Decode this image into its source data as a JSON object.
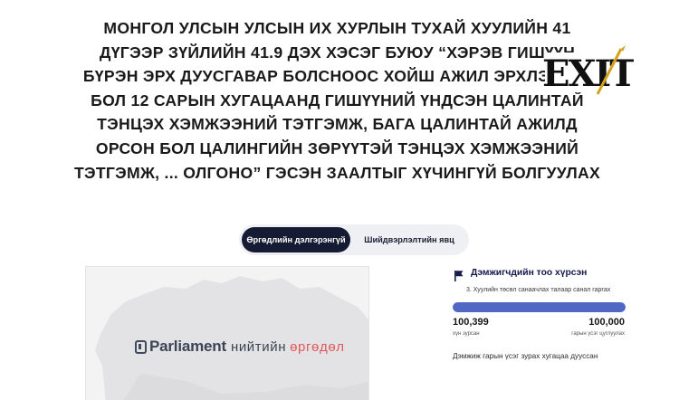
{
  "petition": {
    "title_lines": [
      "МОНГОЛ УЛСЫН УЛСЫН ИХ ХУРЛЫН ТУХАЙ ХУУЛИЙН 41",
      "ДҮГЭЭР ЗҮЙЛИЙН 41.9 ДЭХ ХЭСЭГ БУЮУ “ХЭРЭВ ГИШҮҮН",
      "БҮРЭН ЭРХ ДУУСГАВАР БОЛСНООС ХОЙШ АЖИЛ ЭРХЛЭЭГҮЙ",
      "БОЛ 12 САРЫН ХУГАЦААНД ГИШҮҮНИЙ ҮНДСЭН ЦАЛИНТАЙ",
      "ТЭНЦЭХ ХЭМЖЭЭНИЙ ТЭТГЭМЖ, БАГА ЦАЛИНТАЙ АЖИЛД",
      "ОРСОН БОЛ ЦАЛИНГИЙН ЗӨРҮҮТЭЙ ТЭНЦЭХ ХЭМЖЭЭНИЙ",
      "ТЭТГЭМЖ, ... ОЛГОНО” ГЭСЭН ЗААЛТЫГ ХҮЧИНГҮЙ БОЛГУУЛАХ"
    ]
  },
  "watermark": {
    "text": "EXIT"
  },
  "tabs": {
    "details": "Өргөдлийн дэлгэрэнгүй",
    "decision": "Шийдвэрлэлтийн явц"
  },
  "banner": {
    "brand": "Parliament",
    "public": "нийтийн",
    "forum": "өргөдөл"
  },
  "stats": {
    "title": "Дэмжигчдийн тоо хүрсэн",
    "subtitle": "3. Хуулийн төсөл санаачлах талаар санал гаргах",
    "progress": 1.0,
    "collected": "100,399",
    "collected_caption": "хүн зурсан",
    "goal": "100,000",
    "goal_caption": "гарын үсэг цуглуулах",
    "deadline": "Дэмжиж гарын үсэг зурах хугацаа дууссан"
  },
  "colors": {
    "tab_active": "#161b34",
    "progress_fill": "#5068c4",
    "stats_title": "#14194a",
    "forum_accent": "#e2585a"
  }
}
